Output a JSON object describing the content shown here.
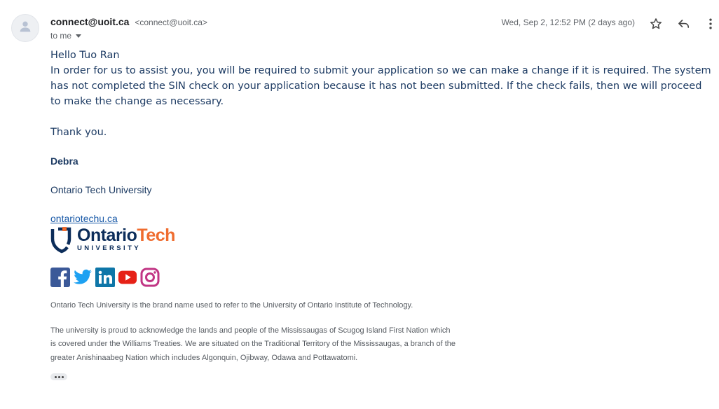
{
  "header": {
    "sender_name": "connect@uoit.ca",
    "sender_email": "<connect@uoit.ca>",
    "to_line": "to me",
    "date": "Wed, Sep 2, 12:52 PM (2 days ago)",
    "icons": [
      "person-icon",
      "star-icon",
      "reply-icon",
      "more-vert-icon"
    ]
  },
  "message": {
    "greeting": "Hello Tuo Ran",
    "paragraph": "In order for us to assist you, you will be required to submit your application so we can make a change if it is required.  The system has not completed the SIN check on your application because it has not been submitted.  If the check fails, then we will proceed to make the change as necessary.",
    "thanks": "Thank you."
  },
  "signature": {
    "name": "Debra",
    "organization": "Ontario Tech University",
    "website": "ontariotechu.ca",
    "logo_ontario": "Ontario",
    "logo_tech": "Tech",
    "logo_sub": "UNIVERSITY",
    "social_icons": [
      "facebook-icon",
      "twitter-icon",
      "linkedin-icon",
      "youtube-icon",
      "instagram-icon"
    ]
  },
  "footer": {
    "brand_note": "Ontario Tech University is the brand name used to refer to the University of Ontario Institute of Technology.",
    "land_acknowledgement": "The university is proud to acknowledge the lands and people of the Mississaugas of Scugog Island First Nation which is covered under the Williams Treaties. We are situated on the Traditional Territory of the Mississaugas, a branch of the greater Anishinaabeg Nation which includes Algonquin, Ojibway, Odawa and Pottawatomi."
  },
  "colors": {
    "body_text": "#1d3b63",
    "link": "#1a5aa8",
    "logo_navy": "#0c2d5a",
    "logo_orange": "#ef6c2f",
    "facebook": "#3b5998",
    "twitter": "#1da1f2",
    "linkedin": "#0e76a8",
    "youtube": "#e62117",
    "instagram": "#c13584"
  }
}
